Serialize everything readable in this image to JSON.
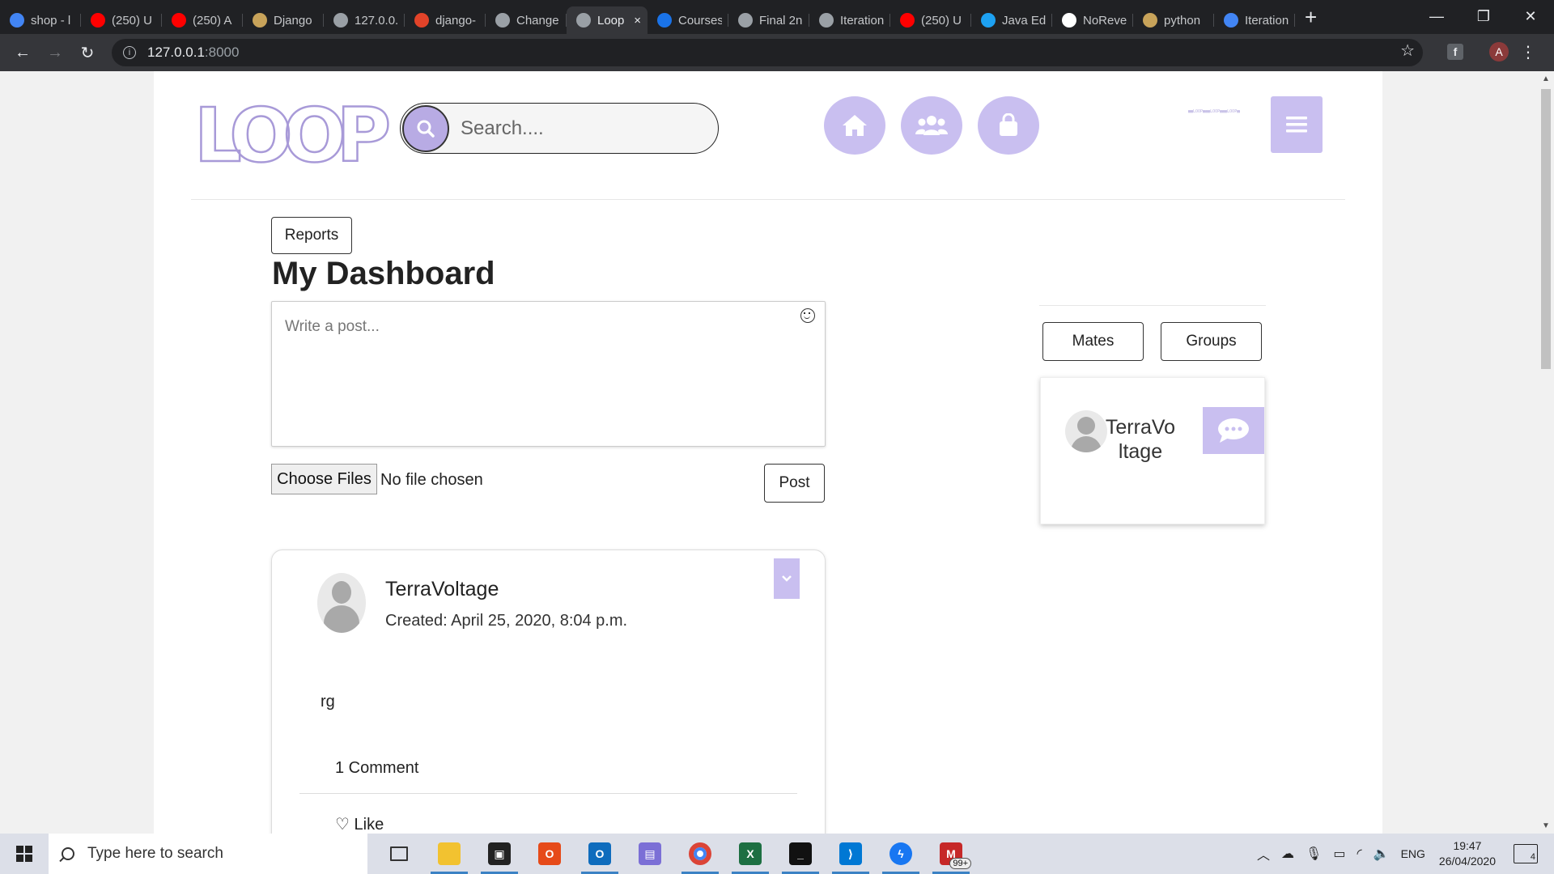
{
  "browser": {
    "tabs": [
      {
        "label": "shop - l",
        "favicon": "shop-favicon",
        "color": "#4285f4"
      },
      {
        "label": "(250) U",
        "favicon": "youtube-favicon",
        "color": "#ff0000"
      },
      {
        "label": "(250) A",
        "favicon": "youtube-favicon",
        "color": "#ff0000"
      },
      {
        "label": "Django",
        "favicon": "django-favicon",
        "color": "#c8a35a"
      },
      {
        "label": "127.0.0.",
        "favicon": "globe-favicon",
        "color": "#9aa0a6"
      },
      {
        "label": "django-",
        "favicon": "gitlab-favicon",
        "color": "#e24329"
      },
      {
        "label": "Change",
        "favicon": "globe-favicon",
        "color": "#9aa0a6"
      },
      {
        "label": "Loop",
        "favicon": "globe-favicon",
        "color": "#9aa0a6",
        "active": true
      },
      {
        "label": "Courses",
        "favicon": "course-favicon",
        "color": "#1a73e8"
      },
      {
        "label": "Final 2n",
        "favicon": "globe-favicon",
        "color": "#9aa0a6"
      },
      {
        "label": "Iteration",
        "favicon": "globe-favicon",
        "color": "#9aa0a6"
      },
      {
        "label": "(250) U",
        "favicon": "youtube-favicon",
        "color": "#ff0000"
      },
      {
        "label": "Java Edi",
        "favicon": "java-favicon",
        "color": "#1da1f2"
      },
      {
        "label": "NoReve",
        "favicon": "globe-favicon",
        "color": "#ffffff"
      },
      {
        "label": "python",
        "favicon": "python-favicon",
        "color": "#c8a35a"
      },
      {
        "label": "Iteration",
        "favicon": "docs-favicon",
        "color": "#4285f4"
      }
    ],
    "close_symbol": "×",
    "new_tab_symbol": "+",
    "url_host": "127.0.0.1",
    "url_port": ":8000",
    "profile_initial": "A"
  },
  "site": {
    "logo": "LOOP",
    "search_placeholder": "Search....",
    "accent_color": "#c9bff0",
    "reports_label": "Reports",
    "page_title": "My Dashboard",
    "post_placeholder": "Write a post...",
    "choose_files_label": "Choose Files",
    "no_file_label": "No file chosen",
    "post_button_label": "Post",
    "mates_label": "Mates",
    "groups_label": "Groups",
    "mate_name": "TerraVoltage"
  },
  "post": {
    "author": "TerraVoltage",
    "created": "Created: April 25, 2020, 8:04 p.m.",
    "text": "rg",
    "comments": "1 Comment",
    "like_label": "Like"
  },
  "taskbar": {
    "search_placeholder": "Type here to search",
    "apps": [
      "task-view-icon",
      "file-explorer-icon",
      "store-icon",
      "office-icon",
      "outlook-icon",
      "photos-icon",
      "chrome-icon",
      "excel-icon",
      "terminal-icon",
      "vscode-icon",
      "messenger-icon",
      "mail-badge-icon"
    ],
    "badge": "99+",
    "language": "ENG",
    "time": "19:47",
    "date": "26/04/2020",
    "notifications": "4"
  }
}
